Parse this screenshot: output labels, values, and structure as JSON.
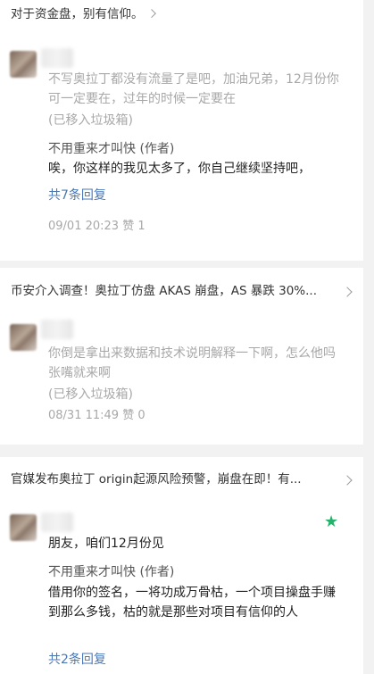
{
  "posts": [
    {
      "title": "对于资金盘，别有信仰。",
      "comment": "不写奥拉丁都没有流量了是吧，加油兄弟，12月份你可一定要在，过年的时候一定要在",
      "status": "(已移入垃圾箱)",
      "reply_author": "不用重来才叫快 (作者)",
      "reply_text": "唉，你这样的我见太多了，你自己继续坚持吧，",
      "replies_link": "共7条回复",
      "meta": "09/01 20:23 赞 1"
    },
    {
      "title": "币安介入调查！奥拉丁仿盘 AKAS 崩盘，AS 暴跌 30%...",
      "comment": "你倒是拿出来数据和技术说明解释一下啊，怎么他吗张嘴就来啊",
      "status": "(已移入垃圾箱)",
      "meta": "08/31 11:49 赞 0"
    },
    {
      "title": "官媒发布奥拉丁 origin起源风险预警，崩盘在即！有...",
      "comment": "朋友，咱们12月份见",
      "reply_author": "不用重来才叫快 (作者)",
      "reply_text": "借用你的签名，一将功成万骨枯，一个项目操盘手赚到那么多钱，枯的就是那些对项目有信仰的人",
      "replies_link": "共2条回复"
    }
  ],
  "icons": {
    "chevron": "chevron-right-icon",
    "star": "star-icon"
  },
  "colors": {
    "link": "#4a78b5",
    "star": "#26b26b"
  }
}
